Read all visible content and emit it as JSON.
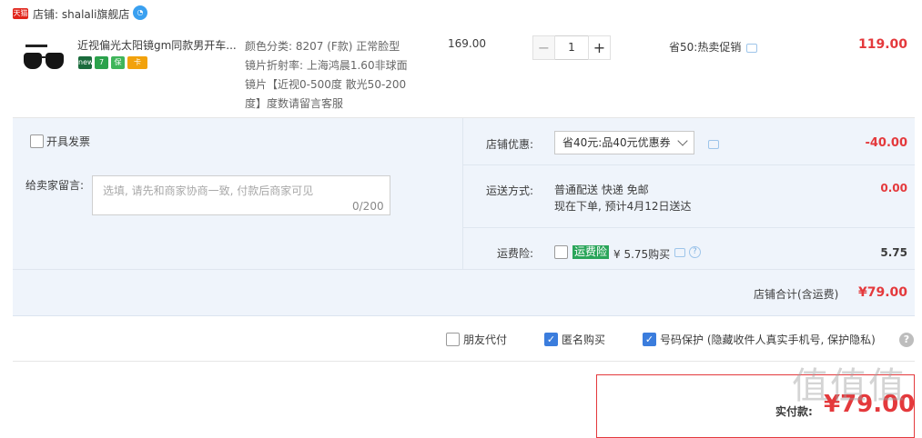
{
  "shop": {
    "badge": "天猫",
    "name": "店铺: shalali旗舰店",
    "ww_icon": "wangwang-icon"
  },
  "item": {
    "title": "近视偏光太阳镜gm同款男开车...",
    "badges": [
      {
        "name": "new-badge-icon",
        "color": "#1a6b3c",
        "text": "new"
      },
      {
        "name": "seven-day-badge-icon",
        "color": "#2ba24c",
        "text": "7"
      },
      {
        "name": "guarantee-badge-icon",
        "color": "#3fb55a",
        "text": "保"
      },
      {
        "name": "card-badge-icon",
        "color": "#f2a20c",
        "text": "卡"
      }
    ],
    "sku_lines": [
      "颜色分类: 8207 (F款) 正常脸型",
      "镜片折射率: 上海鸿晨1.60非球面",
      "镜片【近视0-500度 散光50-200",
      "度】度数请留言客服"
    ],
    "unit_price": "169.00",
    "qty": "1",
    "qty_minus": "−",
    "qty_plus": "+",
    "promo": "省50:热卖促销",
    "total": "119.00"
  },
  "panel": {
    "invoice_label": "开具发票",
    "message_label": "给卖家留言:",
    "message_placeholder": "选填, 请先和商家协商一致, 付款后商家可见",
    "message_count": "0/200",
    "coupon_label": "店铺优惠:",
    "coupon_selected": "省40元:品40元优惠券",
    "coupon_value": "-40.00",
    "ship_label": "运送方式:",
    "ship_line1": "普通配送 快递 免邮",
    "ship_line2": "现在下单, 预计4月12日送达",
    "ship_value": "0.00",
    "insurance_label": "运费险:",
    "insurance_tag": "运费险",
    "insurance_price": "¥ 5.75购买",
    "insurance_help": "?",
    "insurance_value": "5.75",
    "subtotal_label": "店铺合计(含运费)",
    "subtotal_value": "¥79.00"
  },
  "options": {
    "friend_pay": "朋友代付",
    "anonymous": "匿名购买",
    "number_protect": "号码保护 (隐藏收件人真实手机号, 保护隐私)",
    "help": "?"
  },
  "payment": {
    "label": "实付款:",
    "value": "¥79.00"
  },
  "watermark": "值值值",
  "colors": {
    "accent_red": "#e4393c",
    "panel_bg": "#eff4fb",
    "checkbox_blue": "#3b7ddd"
  }
}
